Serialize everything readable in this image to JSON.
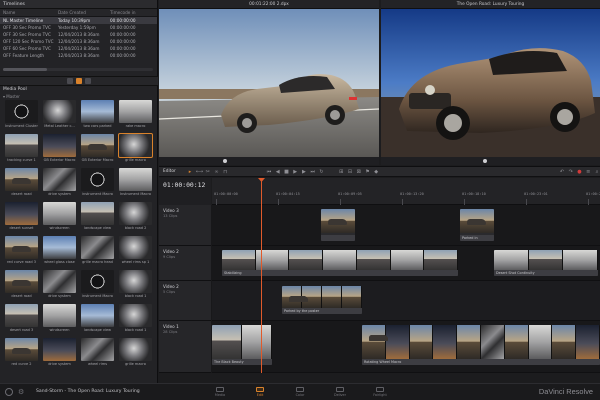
{
  "app": {
    "brand": "DaVinci Resolve",
    "project": "Sand-Storm - The Open Road: Luxury Touring",
    "accent": "#d9822b",
    "playhead_color": "#e05a2b"
  },
  "timelines": {
    "title": "Timelines",
    "columns": [
      "Name",
      "Date Created",
      "Timecode in"
    ],
    "rows": [
      {
        "name": "NL  Master Timeline",
        "date": "Today 10:39pm",
        "tc": "00:00:00:00",
        "selected": true
      },
      {
        "name": "OFF 30 Sec Promo TVC",
        "date": "Yesterday 1:59pm",
        "tc": "00:00:00:00",
        "selected": false
      },
      {
        "name": "OFF 30 Sec Promo TVC",
        "date": "12/04/2013 8:36am",
        "tc": "00:00:00:00",
        "selected": false
      },
      {
        "name": "OFF 120 Sec Promo TVC",
        "date": "12/04/2013 8:36am",
        "tc": "00:00:00:00",
        "selected": false
      },
      {
        "name": "OFF 60 Sec Promo TVC",
        "date": "12/04/2013 8:36am",
        "tc": "00:00:00:00",
        "selected": false
      },
      {
        "name": "OFF Feature Length",
        "date": "12/04/2013 8:36am",
        "tc": "00:00:00:00",
        "selected": false
      }
    ]
  },
  "media_pool": {
    "title": "Media Pool",
    "bin": "Master",
    "clips": [
      {
        "label": "Instrument Cluster",
        "thumb": "t-gauge"
      },
      {
        "label": "Metal Leather c...",
        "thumb": "t-metal"
      },
      {
        "label": "two cars parked",
        "thumb": "t-blue"
      },
      {
        "label": "rake macro",
        "thumb": "t-light"
      },
      {
        "label": "tracking curve 1",
        "thumb": "t-road"
      },
      {
        "label": "GB Exterior Macro",
        "thumb": "t-night"
      },
      {
        "label": "GB Exterior Macro",
        "thumb": "t-car"
      },
      {
        "label": "grille macro",
        "thumb": "t-metal"
      },
      {
        "label": "desert road",
        "thumb": "t-car"
      },
      {
        "label": "drive system",
        "thumb": "t-engine"
      },
      {
        "label": "instrument Macro",
        "thumb": "t-gauge"
      },
      {
        "label": "Instrument Macro",
        "thumb": "t-light"
      },
      {
        "label": "desert sunset",
        "thumb": "t-night"
      },
      {
        "label": "windscreen",
        "thumb": "t-light"
      },
      {
        "label": "landscape view",
        "thumb": "t-road"
      },
      {
        "label": "black road 2",
        "thumb": "t-metal"
      },
      {
        "label": "red curve road 3",
        "thumb": "t-car"
      },
      {
        "label": "wheel glass close",
        "thumb": "t-blue"
      },
      {
        "label": "grille macro head",
        "thumb": "t-engine"
      },
      {
        "label": "wheel rims sp 1",
        "thumb": "t-metal"
      },
      {
        "label": "desert road",
        "thumb": "t-car"
      },
      {
        "label": "drive system",
        "thumb": "t-engine"
      },
      {
        "label": "instrument Macro",
        "thumb": "t-gauge"
      },
      {
        "label": "black road 1",
        "thumb": "t-metal"
      },
      {
        "label": "desert road 3",
        "thumb": "t-road"
      },
      {
        "label": "windscreen",
        "thumb": "t-light"
      },
      {
        "label": "landscape view",
        "thumb": "t-blue"
      },
      {
        "label": "black road 1",
        "thumb": "t-metal"
      },
      {
        "label": "red curve 2",
        "thumb": "t-car"
      },
      {
        "label": "drive system",
        "thumb": "t-night"
      },
      {
        "label": "wheel rims",
        "thumb": "t-engine"
      },
      {
        "label": "grille macro",
        "thumb": "t-metal"
      }
    ]
  },
  "viewers": {
    "source_title": "00:01:22:00 2.dpx",
    "program_title": "The Open Road: Luxury Touring"
  },
  "toolbar": {
    "label": "Editor"
  },
  "timecode": "01:00:00:12",
  "ruler_ticks": [
    "01:00:00:00",
    "01:00:04:15",
    "01:00:09:05",
    "01:00:13:20",
    "01:00:18:10",
    "01:00:23:01",
    "01:00:27:15"
  ],
  "tracks": [
    {
      "name": "Video 3",
      "sub": "13 Clips"
    },
    {
      "name": "Video 2",
      "sub": "9 Clips"
    },
    {
      "name": "Video 2",
      "sub": "5 Clips"
    },
    {
      "name": "Video 1",
      "sub": "28 Clips"
    }
  ],
  "clip_captions": {
    "v3a": "",
    "v3b": "Parked in",
    "v2a": "Stabilizing",
    "v2b": "Desert Shot Continuity",
    "v2c": "Parked by the poster",
    "v1a": "The Black Beauty",
    "v1b": "Rotating Wheel Macro"
  },
  "pages": [
    "Media",
    "Edit",
    "Color",
    "Deliver",
    "Fairlight"
  ]
}
